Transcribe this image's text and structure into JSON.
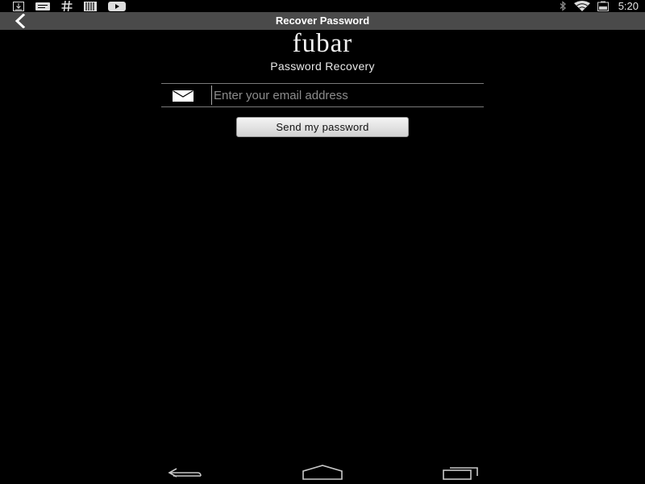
{
  "status_bar": {
    "left_icons": [
      "download-icon",
      "message-icon",
      "hash-icon",
      "barcode-icon",
      "youtube-icon"
    ],
    "right_icons": [
      "bluetooth-icon",
      "wifi-icon",
      "battery-icon"
    ],
    "time": "5:20"
  },
  "action_bar": {
    "title": "Recover Password",
    "back_icon": "back-chevron-icon"
  },
  "main": {
    "logo": "fubar",
    "subtitle": "Password Recovery",
    "email_placeholder": "Enter your email address",
    "email_value": "",
    "send_button_label": "Send my password"
  },
  "nav_bar": {
    "buttons": [
      "back-nav-icon",
      "home-nav-icon",
      "recents-nav-icon"
    ]
  },
  "colors": {
    "background": "#000000",
    "action_bar": "#4a4a4a",
    "button_bg": "#e6e6e6",
    "divider": "#7a7a7a"
  }
}
